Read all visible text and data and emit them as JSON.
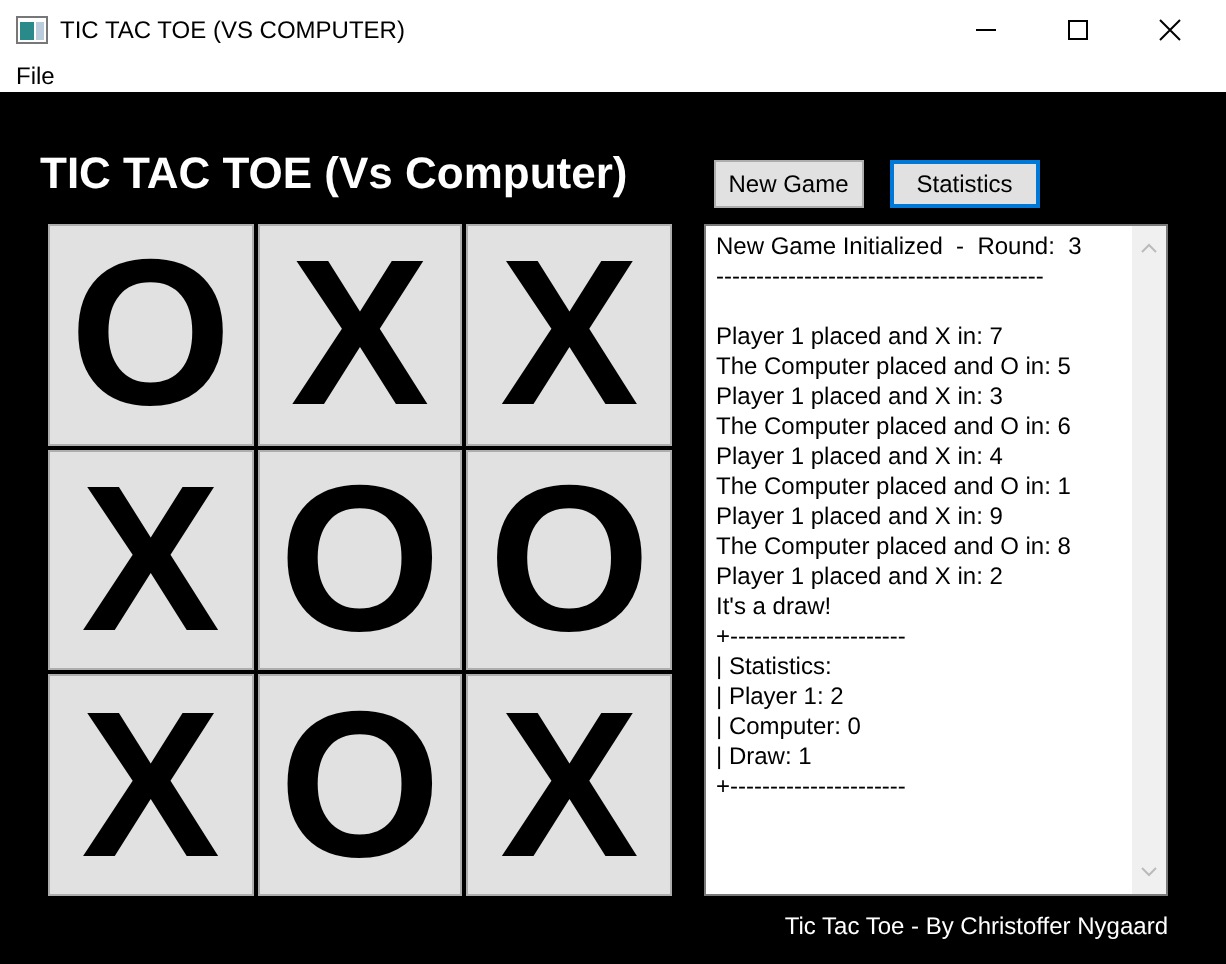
{
  "window": {
    "title": "TIC TAC TOE (VS COMPUTER)"
  },
  "menu": [
    "File"
  ],
  "heading": "TIC TAC TOE (Vs Computer)",
  "buttons": [
    {
      "label": "New Game",
      "selected": false
    },
    {
      "label": "Statistics",
      "selected": true
    }
  ],
  "board": [
    "O",
    "X",
    "X",
    "X",
    "O",
    "O",
    "X",
    "O",
    "X"
  ],
  "log": {
    "header": [
      "New Game Initialized  -  Round:  3",
      "-----------------------------------------"
    ],
    "lines": [
      "Player 1 placed and X in: 7",
      "The Computer placed and O in: 5",
      "Player 1 placed and X in: 3",
      "The Computer placed and O in: 6",
      "Player 1 placed and X in: 4",
      "The Computer placed and O in: 1",
      "Player 1 placed and X in: 9",
      "The Computer placed and O in: 8",
      "Player 1 placed and X in: 2",
      "It's a draw!",
      "+----------------------",
      "| Statistics:",
      "| Player 1: 2",
      "| Computer: 0",
      "| Draw: 1",
      "+----------------------"
    ]
  },
  "footer": "Tic Tac Toe - By Christoffer Nygaard"
}
